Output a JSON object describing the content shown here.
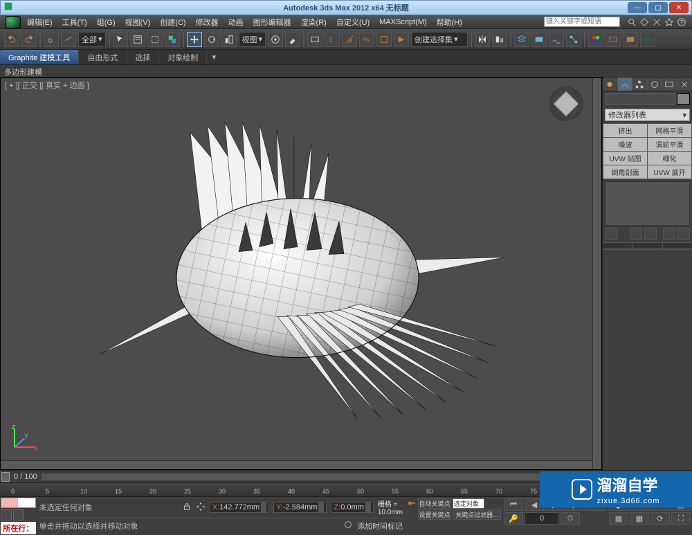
{
  "window": {
    "title": "Autodesk 3ds Max  2012 x64    无标题"
  },
  "menubar": {
    "items": [
      "编辑(E)",
      "工具(T)",
      "组(G)",
      "视图(V)",
      "创建(C)",
      "修改器",
      "动画",
      "图形编辑器",
      "渲染(R)",
      "自定义(U)",
      "MAXScript(M)",
      "帮助(H)"
    ],
    "search_placeholder": "键入关键字或短语"
  },
  "toolbar": {
    "all_dropdown": "全部",
    "view_dropdown": "视图",
    "create_set_dropdown": "创建选择集"
  },
  "ribbon": {
    "tabs": [
      "Graphite 建模工具",
      "自由形式",
      "选择",
      "对象绘制"
    ],
    "active": 0,
    "sublabel": "多边形建模"
  },
  "viewport": {
    "label": "[ + ][ 正交 ][ 真实 + 边面 ]"
  },
  "cmd_panel": {
    "modifier_list_label": "修改器列表",
    "modifiers": [
      [
        "挤出",
        "网格平滑"
      ],
      [
        "噪波",
        "涡轮平滑"
      ],
      [
        "UVW 贴图",
        "细化"
      ],
      [
        "倒角剖面",
        "UVW 展开"
      ]
    ]
  },
  "time_slider": {
    "label": "0 / 100"
  },
  "ruler_ticks": [
    "0",
    "5",
    "10",
    "15",
    "20",
    "25",
    "30",
    "35",
    "40",
    "45",
    "50",
    "55",
    "60",
    "65",
    "70",
    "75"
  ],
  "status": {
    "none_selected": "未选定任何对象",
    "x": "142.772mm",
    "y": "-2.584mm",
    "z": "0.0mm",
    "grid": "栅格 = 10.0mm",
    "prompt": "单击并拖动以选择并移动对象",
    "add_time_tag": "添加时间标记",
    "location_label": "所在行：",
    "auto_key": "自动关键点",
    "set_key": "设置关键点",
    "selected_obj": "选定对象",
    "key_filters": "关键点过滤器..."
  },
  "watermark": {
    "big": "溜溜自学",
    "small": "zixue.3d66.com"
  }
}
